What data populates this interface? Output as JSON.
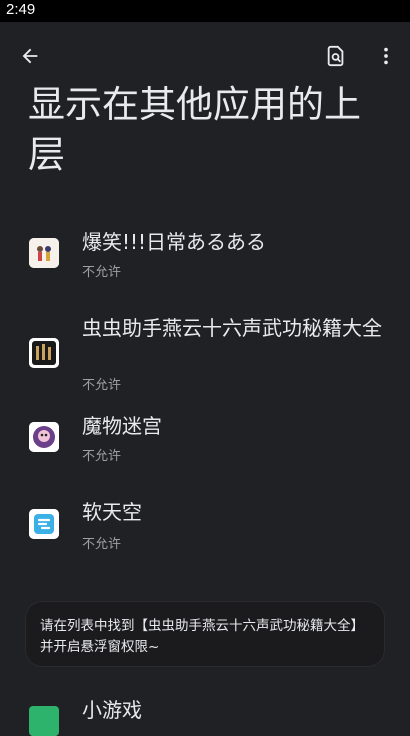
{
  "status_bar": {
    "time": "2:49"
  },
  "toolbar": {
    "back_icon": "arrow-back-icon",
    "search_icon": "search-in-page-icon",
    "more_icon": "more-vert-icon"
  },
  "page": {
    "title": "显示在其他应用的上层"
  },
  "apps": [
    {
      "name": "爆笑!!!日常あるある",
      "status": "不允许"
    },
    {
      "name": "虫虫助手燕云十六声武功秘籍大全",
      "status": "不允许"
    },
    {
      "name": "魔物迷宫",
      "status": "不允许"
    },
    {
      "name": "软天空",
      "status": "不允许"
    },
    {
      "name": "小游戏",
      "status": ""
    }
  ],
  "tip": {
    "text": "请在列表中找到【虫虫助手燕云十六声武功秘籍大全】并开启悬浮窗权限~"
  }
}
